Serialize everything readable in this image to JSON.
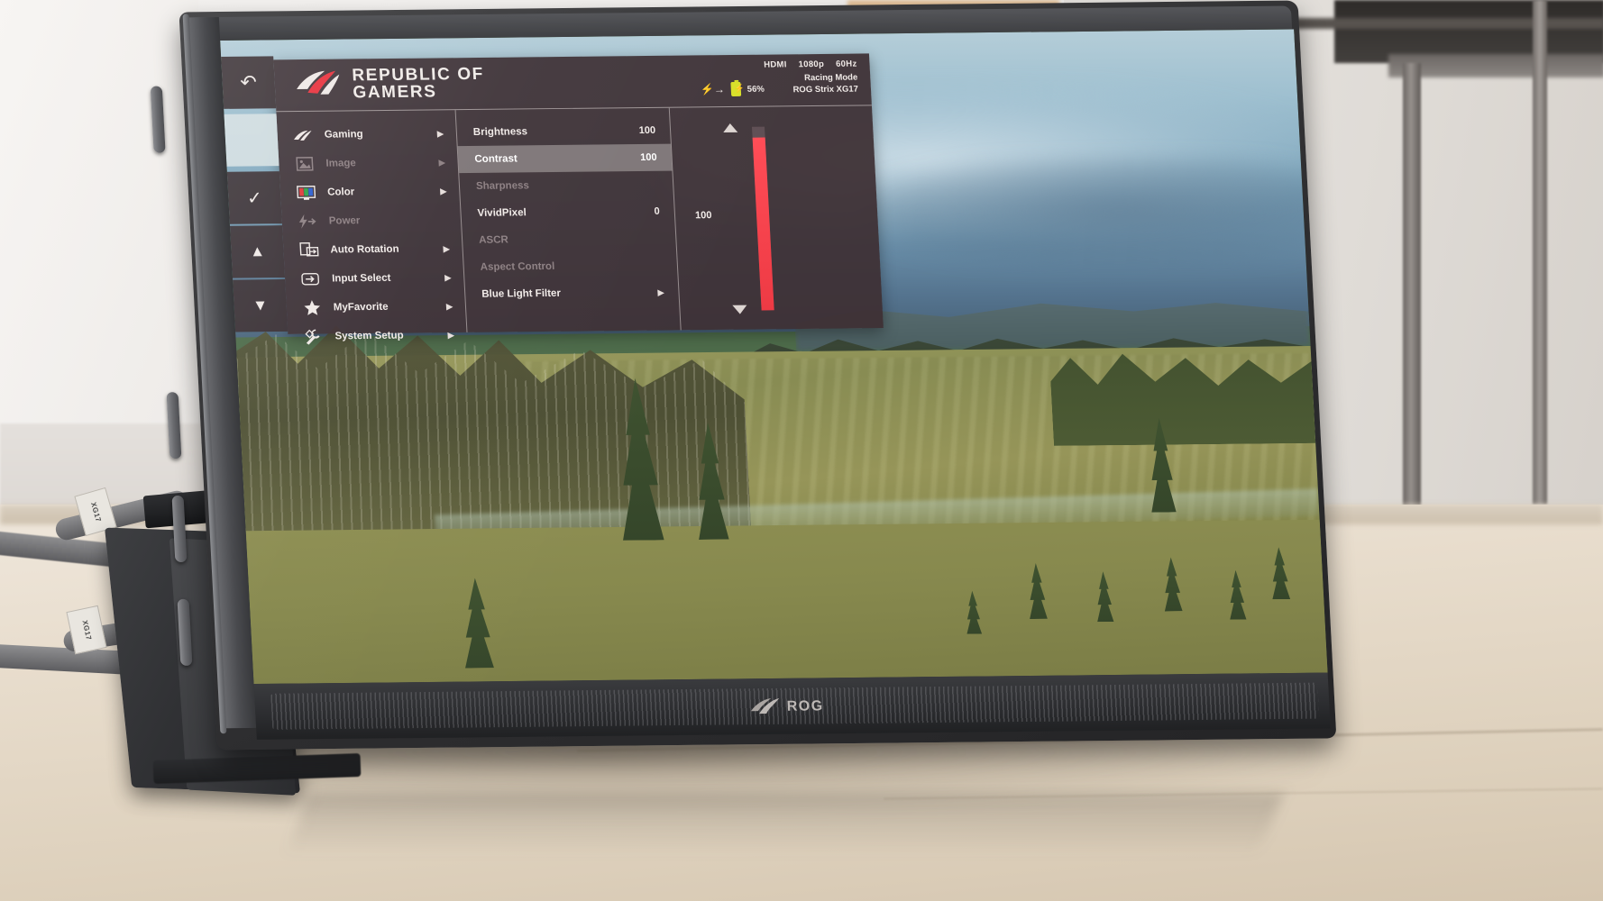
{
  "device": {
    "name": "ROG Strix XG17 portable monitor",
    "brand_logo_line1": "REPUBLIC OF",
    "brand_logo_line2": "GAMERS",
    "chin_logo_text": "ROG"
  },
  "osd": {
    "header": {
      "brand_line1": "REPUBLIC OF",
      "brand_line2": "GAMERS",
      "input": "HDMI",
      "resolution": "1080p",
      "refresh_rate": "60Hz",
      "mode": "Racing Mode",
      "model": "ROG Strix XG17",
      "battery_percent": "56%",
      "battery_icon": "battery-charging-icon",
      "power_icon": "power-bolt-icon"
    },
    "menu": [
      {
        "label": "Gaming",
        "icon": "rog-logo-icon",
        "enabled": true,
        "arrow": "▶"
      },
      {
        "label": "Image",
        "icon": "image-icon",
        "enabled": false,
        "arrow": "▶"
      },
      {
        "label": "Color",
        "icon": "color-rgb-icon",
        "enabled": true,
        "arrow": "▶"
      },
      {
        "label": "Power",
        "icon": "power-bolt-icon",
        "enabled": false,
        "arrow": ""
      },
      {
        "label": "Auto Rotation",
        "icon": "auto-rotation-icon",
        "enabled": true,
        "arrow": "▶"
      },
      {
        "label": "Input Select",
        "icon": "input-select-icon",
        "enabled": true,
        "arrow": "▶"
      },
      {
        "label": "MyFavorite",
        "icon": "star-icon",
        "enabled": true,
        "arrow": "▶"
      },
      {
        "label": "System Setup",
        "icon": "wrench-icon",
        "enabled": true,
        "arrow": "▶"
      }
    ],
    "submenu": [
      {
        "label": "Brightness",
        "value": "100",
        "enabled": true,
        "selected": false,
        "arrow": ""
      },
      {
        "label": "Contrast",
        "value": "100",
        "enabled": true,
        "selected": true,
        "arrow": ""
      },
      {
        "label": "Sharpness",
        "value": "",
        "enabled": false,
        "selected": false,
        "arrow": ""
      },
      {
        "label": "VividPixel",
        "value": "0",
        "enabled": true,
        "selected": false,
        "arrow": ""
      },
      {
        "label": "ASCR",
        "value": "",
        "enabled": false,
        "selected": false,
        "arrow": ""
      },
      {
        "label": "Aspect Control",
        "value": "",
        "enabled": false,
        "selected": false,
        "arrow": ""
      },
      {
        "label": "Blue Light Filter",
        "value": "",
        "enabled": true,
        "selected": false,
        "arrow": "▶"
      }
    ],
    "slider": {
      "value": "100",
      "fill_percent": 94,
      "up_arrow": "scroll-up-arrow",
      "down_arrow": "scroll-down-arrow",
      "color": "#ee3a44"
    },
    "colors": {
      "panel_bg": "#3e3034",
      "accent_red": "#ee3a44",
      "text": "#f0eae7",
      "text_disabled": "#8e8184",
      "highlight": "#d7d2d0",
      "battery_yellow": "#d9e02a"
    }
  },
  "button_hints": [
    {
      "glyph": "↶",
      "name": "back-button-hint",
      "active": true
    },
    {
      "glyph": "",
      "name": "blank-button-hint",
      "active": false
    },
    {
      "glyph": "✓",
      "name": "confirm-button-hint",
      "active": true
    },
    {
      "glyph": "▲",
      "name": "up-button-hint",
      "active": true
    },
    {
      "glyph": "▼",
      "name": "down-button-hint",
      "active": true
    }
  ],
  "cables": [
    {
      "label": "XG17",
      "name": "usb-c-cable-upper"
    },
    {
      "label": "XG17",
      "name": "usb-c-cable-lower"
    }
  ],
  "wallpaper": {
    "description": "field and forest landscape with overcast sky"
  }
}
